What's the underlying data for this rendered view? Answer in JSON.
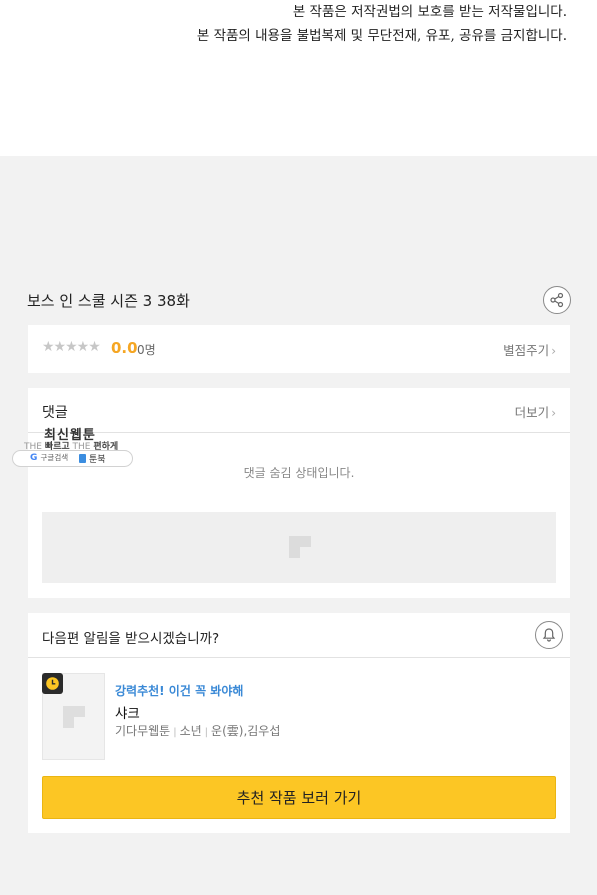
{
  "notice": {
    "line1": "본 작품은 저작권법의 보호를 받는 저작물입니다.",
    "line2": "본 작품의 내용을 불법복제 및 무단전재, 유포, 공유를 금지합니다."
  },
  "episode": {
    "title": "보스 인 스쿨 시즌 3 38화"
  },
  "rating": {
    "stars": "★★★★★",
    "stars_filled": 0,
    "score": "0.0",
    "count": "0명",
    "rate_label": "별점주기"
  },
  "comments": {
    "header": "댓글",
    "more_label": "더보기",
    "empty_text": "댓글 숨김 상태입니다."
  },
  "overlay": {
    "title": "최신웹툰",
    "slogan_the1": "THE",
    "slogan_fast": "빠르고",
    "slogan_the2": "THE",
    "slogan_easy": "편하게",
    "google_label": "구글검색",
    "toonbook_label": "툰북"
  },
  "notify": {
    "question": "다음편 알림을 받으시겠습니까?"
  },
  "recommend": {
    "tag": "강력추천! 이건 꼭 봐야해",
    "title": "샤크",
    "meta": [
      "기다무웹툰",
      "소년",
      "운(雲),김우섭"
    ],
    "cta_label": "추천 작품 보러 가기"
  },
  "colors": {
    "accent_yellow": "#fcc624",
    "score_orange": "#f5a623",
    "tag_blue": "#3a89d6"
  },
  "icons": [
    "share-icon",
    "star-icon",
    "chevron-right-icon",
    "image-placeholder-icon",
    "bell-icon",
    "clock-icon",
    "google-icon",
    "book-icon"
  ]
}
